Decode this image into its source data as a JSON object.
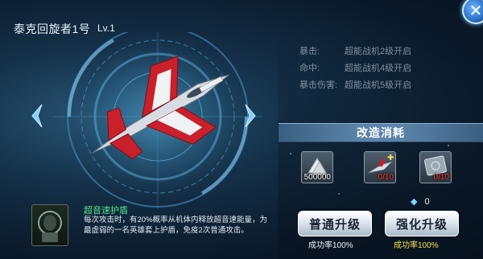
{
  "ship": {
    "name": "泰克回旋者1号",
    "level": "Lv.1"
  },
  "stats": [
    {
      "label": "暴击:",
      "value": "超能战机2级开启"
    },
    {
      "label": "命中:",
      "value": "超能战机4级开启"
    },
    {
      "label": "暴击伤害:",
      "value": "超能战机5级开启"
    }
  ],
  "cost": {
    "title": "改造消耗",
    "items": [
      {
        "name": "upgrade-card",
        "count": "500000"
      },
      {
        "name": "jet-fragment",
        "count": "0/10"
      },
      {
        "name": "blueprint-stamp",
        "count": "0/10"
      }
    ],
    "gem_count": "0"
  },
  "actions": {
    "normal": {
      "label": "普通升级",
      "rate": "成功率100%"
    },
    "enhanced": {
      "label": "强化升级",
      "rate": "成功率100%"
    }
  },
  "skill": {
    "name": "超音速护盾",
    "description": "每次攻击时，有20%概率从机体内释放超音速能量，为最虚弱的一名英雄套上护盾，免疫2次普通攻击。"
  },
  "colors": {
    "accent_green": "#55e38a",
    "rate_white": "#e9f2f8",
    "rate_yellow": "#f4e04a",
    "count_red": "#ff3b3b"
  }
}
